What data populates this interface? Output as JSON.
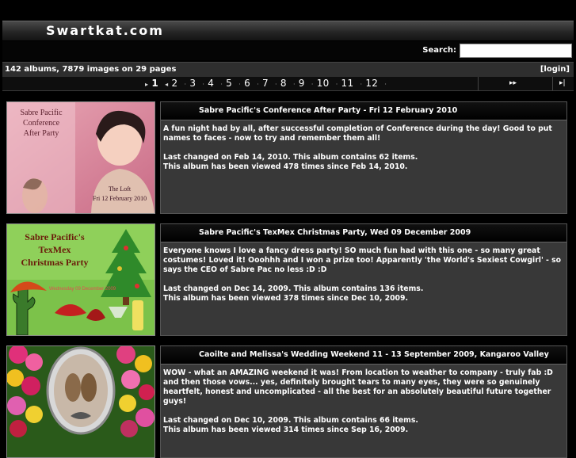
{
  "site": {
    "title": "Swartkat.com"
  },
  "search": {
    "label": "Search:",
    "placeholder": ""
  },
  "info": {
    "summary": "142 albums, 7879 images on 29 pages",
    "login": "[login]"
  },
  "pager": {
    "pages": [
      "1",
      "2",
      "3",
      "4",
      "5",
      "6",
      "7",
      "8",
      "9",
      "10",
      "11",
      "12"
    ],
    "current": "1",
    "next_icon": "fast-forward-icon",
    "last_icon": "skip-to-end-icon"
  },
  "albums": [
    {
      "title": "Sabre Pacific's Conference After Party - Fri 12 February 2010",
      "description": "A fun night had by all, after successful completion of Conference during the day! Good to put names to faces - now to try and remember them all!",
      "changed": "Last changed on Feb 14, 2010. This album contains 62 items.",
      "views": "This album has been viewed 478 times since Feb 14, 2010.",
      "thumb_lines": [
        "Sabre Pacific",
        "Conference",
        "After Party"
      ],
      "thumb_footer": [
        "The Loft",
        "Fri 12 February 2010"
      ]
    },
    {
      "title": "Sabre Pacific's TexMex Christmas Party, Wed 09 December 2009",
      "description": "Everyone knows I love a fancy dress party! SO much fun had with this one - so many great costumes! Loved it! Ooohhh and I won a prize too! Apparently 'the World's Sexiest Cowgirl' - so says the CEO of Sabre Pac no less :D :D",
      "changed": "Last changed on Dec 14, 2009. This album contains 136 items.",
      "views": "This album has been viewed 378 times since Dec 10, 2009.",
      "thumb_lines": [
        "Sabre Pacific's",
        "TexMex",
        "Christmas Party"
      ],
      "thumb_footer": [
        "Wednesday 09 December 2009"
      ]
    },
    {
      "title": "Caoilte and Melissa's Wedding Weekend 11 - 13 September 2009, Kangaroo Valley",
      "description": "WOW - what an AMAZING weekend it was! From location to weather to company - truly fab :D and then those vows... yes, definitely brought tears to many eyes, they were so genuinely heartfelt, honest and uncomplicated - all the best for an absolutely beautiful future together guys!",
      "changed": "Last changed on Dec 10, 2009. This album contains 66 items.",
      "views": "This album has been viewed 314 times since Sep 16, 2009."
    }
  ]
}
